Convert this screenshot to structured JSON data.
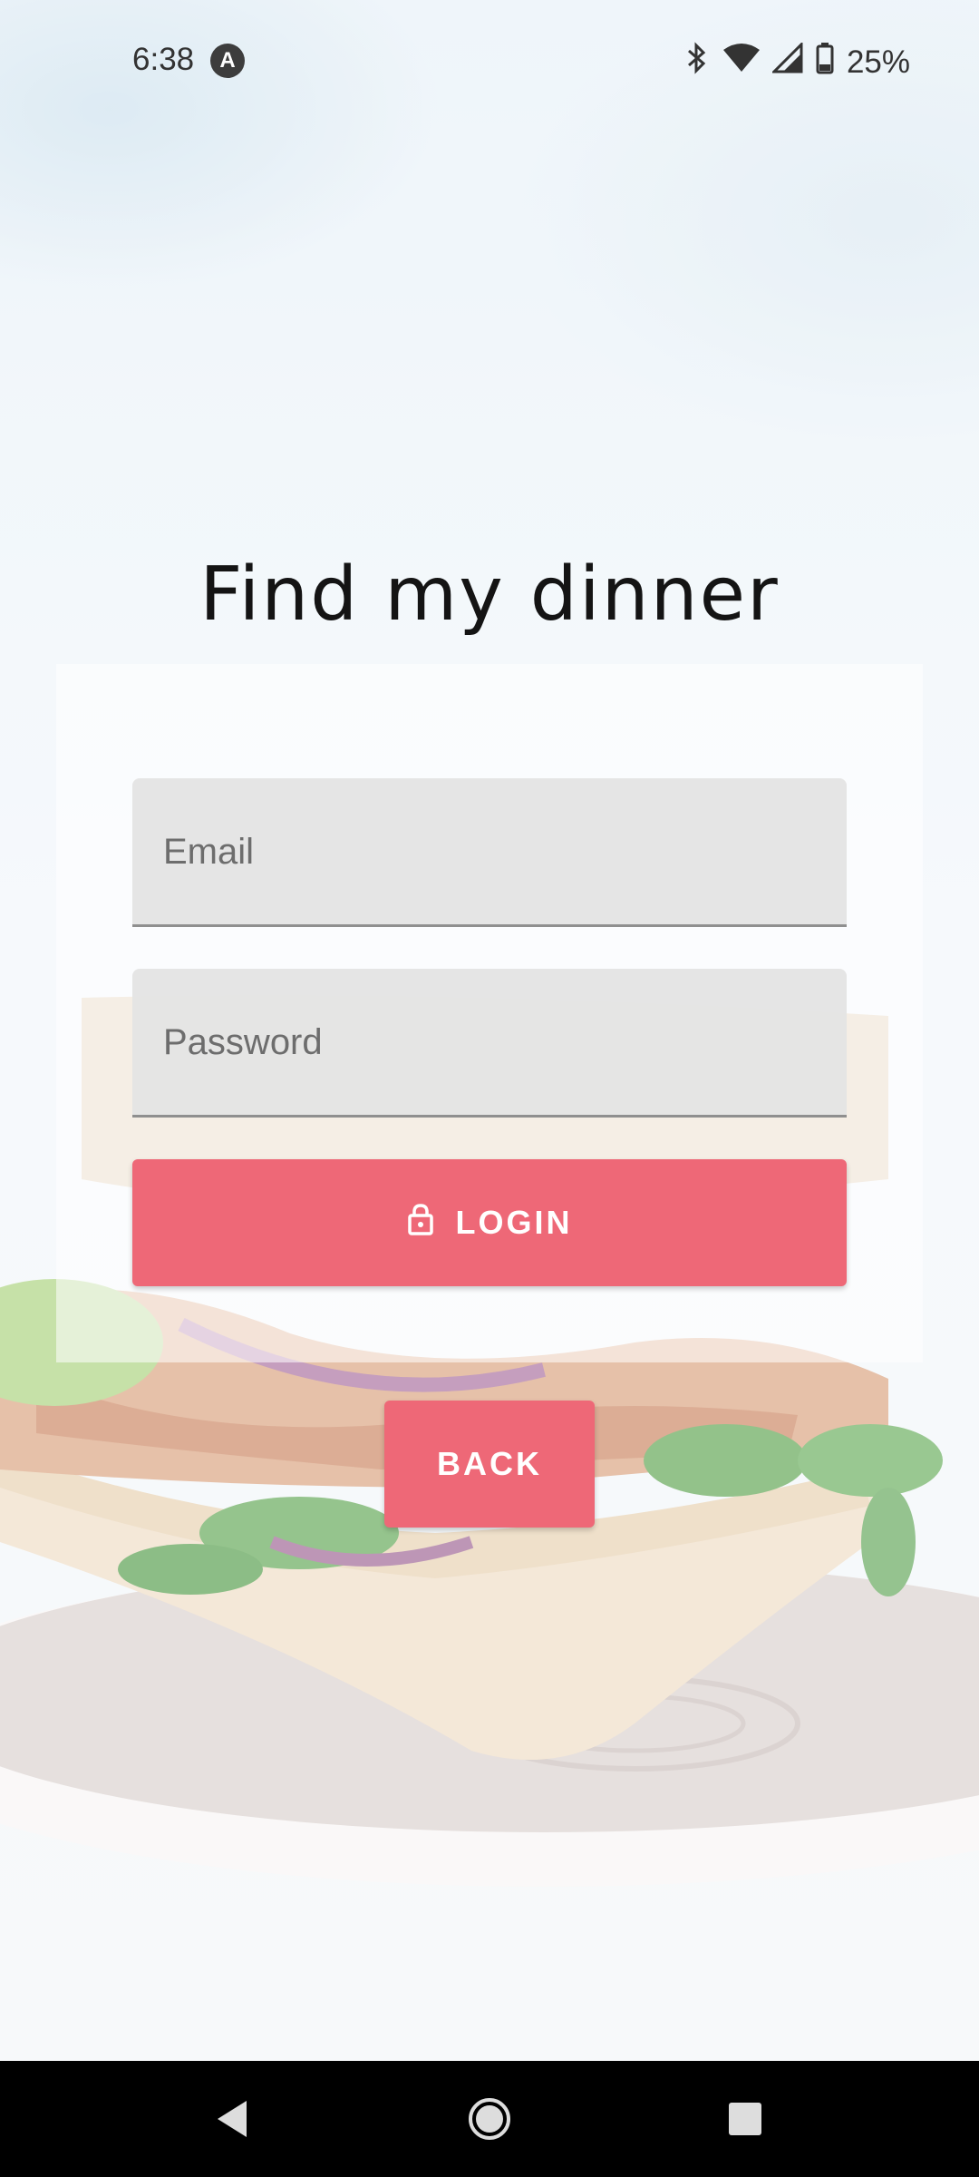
{
  "status_bar": {
    "time": "6:38",
    "battery": "25%",
    "icons": [
      "app-notification-icon",
      "bluetooth-icon",
      "wifi-icon",
      "cell-signal-icon",
      "battery-icon"
    ]
  },
  "app": {
    "title": "Find my dinner"
  },
  "form": {
    "email_placeholder": "Email",
    "password_placeholder": "Password",
    "login_label": "LOGIN",
    "back_label": "BACK"
  },
  "colors": {
    "accent": "#ee6877",
    "field_bg": "#e4e4e4",
    "nav_bar": "#000000"
  },
  "nav_bar": {
    "buttons": [
      "back-icon",
      "home-icon",
      "recents-icon"
    ]
  }
}
